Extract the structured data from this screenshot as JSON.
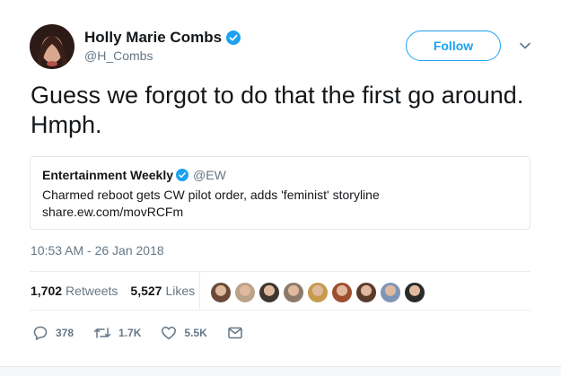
{
  "author": {
    "display_name": "Holly Marie Combs",
    "handle": "@H_Combs",
    "verified": true
  },
  "follow_label": "Follow",
  "tweet_text": "Guess we forgot to do that the first go around. Hmph.",
  "quoted_tweet": {
    "name": "Entertainment Weekly",
    "handle": "@EW",
    "verified": true,
    "text": "Charmed reboot gets CW pilot order, adds 'feminist' storyline",
    "link": "share.ew.com/movRCFm"
  },
  "timestamp": "10:53 AM - 26 Jan 2018",
  "stats": {
    "retweets_count": "1,702",
    "retweets_label": "Retweets",
    "likes_count": "5,527",
    "likes_label": "Likes"
  },
  "likers": [
    {
      "name": "liker-1",
      "color": "#6b4a3a"
    },
    {
      "name": "liker-2",
      "color": "#b9a48a"
    },
    {
      "name": "liker-3",
      "color": "#3d3530"
    },
    {
      "name": "liker-4",
      "color": "#8c7a6b"
    },
    {
      "name": "liker-5",
      "color": "#c79a4b"
    },
    {
      "name": "liker-6",
      "color": "#9e4f2f"
    },
    {
      "name": "liker-7",
      "color": "#5a3b2b"
    },
    {
      "name": "liker-8",
      "color": "#7f95b8"
    },
    {
      "name": "liker-9",
      "color": "#2a2a2a"
    }
  ],
  "actions": {
    "replies": "378",
    "retweets": "1.7K",
    "likes": "5.5K"
  },
  "colors": {
    "accent": "#1da1f2",
    "muted": "#657786",
    "text": "#14171a",
    "border": "#e1e8ed"
  },
  "icons": [
    "verified-badge-icon",
    "chevron-down-icon",
    "reply-icon",
    "retweet-icon",
    "heart-icon",
    "message-icon"
  ]
}
